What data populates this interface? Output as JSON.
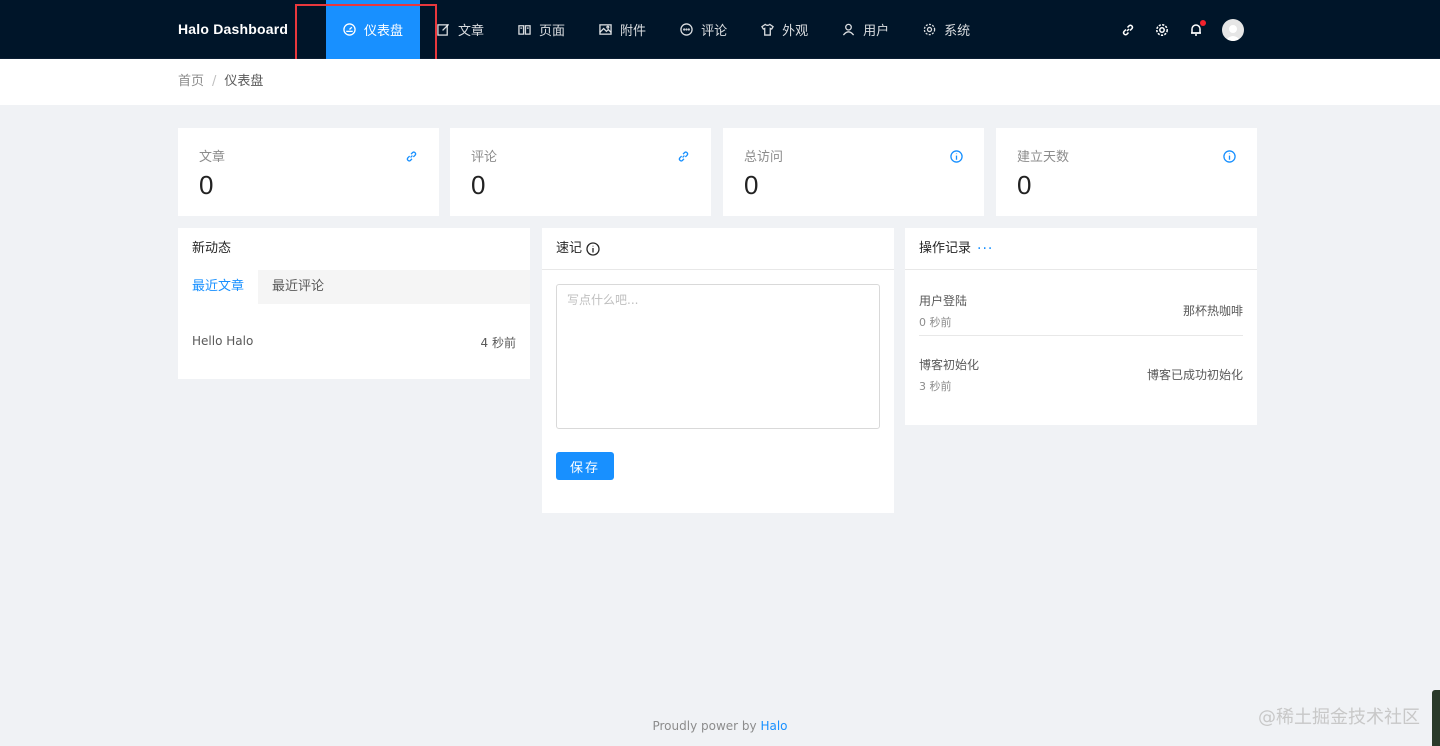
{
  "brand": "Halo  Dashboard",
  "nav": [
    {
      "label": "仪表盘",
      "icon": "dashboard-icon",
      "active": true
    },
    {
      "label": "文章",
      "icon": "edit-icon"
    },
    {
      "label": "页面",
      "icon": "book-icon"
    },
    {
      "label": "附件",
      "icon": "picture-icon"
    },
    {
      "label": "评论",
      "icon": "message-icon"
    },
    {
      "label": "外观",
      "icon": "skin-icon"
    },
    {
      "label": "用户",
      "icon": "user-icon"
    },
    {
      "label": "系统",
      "icon": "setting-icon"
    }
  ],
  "breadcrumb": {
    "home": "首页",
    "current": "仪表盘"
  },
  "stats": [
    {
      "label": "文章",
      "value": "0",
      "icon": "link-icon"
    },
    {
      "label": "评论",
      "value": "0",
      "icon": "link-icon"
    },
    {
      "label": "总访问",
      "value": "0",
      "icon": "info-icon"
    },
    {
      "label": "建立天数",
      "value": "0",
      "icon": "info-icon"
    }
  ],
  "activity": {
    "title": "新动态",
    "tabs": [
      "最近文章",
      "最近评论"
    ],
    "posts": [
      {
        "title": "Hello Halo",
        "time": "4 秒前"
      }
    ]
  },
  "notes": {
    "title": "速记",
    "placeholder": "写点什么吧...",
    "save_label": "保存"
  },
  "logs": {
    "title": "操作记录",
    "items": [
      {
        "type": "用户登陆",
        "time": "0 秒前",
        "content": "那杯热咖啡"
      },
      {
        "type": "博客初始化",
        "time": "3 秒前",
        "content": "博客已成功初始化"
      }
    ]
  },
  "footer": {
    "prefix": "Proudly power by ",
    "link": "Halo"
  },
  "watermark": "@稀土掘金技术社区",
  "colors": {
    "header": "#001529",
    "accent": "#1890ff",
    "highlight": "#e8383d"
  }
}
